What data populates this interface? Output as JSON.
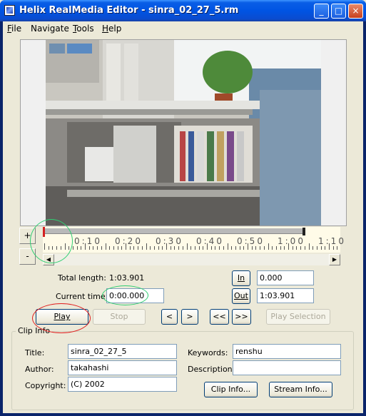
{
  "window": {
    "title": "Helix RealMedia Editor - sinra_02_27_5.rm",
    "controls": [
      "_",
      "□",
      "×"
    ]
  },
  "menu": [
    {
      "label": "File",
      "accel": "F",
      "rest": "ile"
    },
    {
      "label": "Navigate",
      "accel": "",
      "rest": "Navigate"
    },
    {
      "label": "Tools",
      "accel": "T",
      "rest": "ools"
    },
    {
      "label": "Help",
      "accel": "H",
      "rest": "elp"
    }
  ],
  "zoom": {
    "plus": "+",
    "minus": "-"
  },
  "timeline": {
    "labels": [
      "0:10",
      "0:20",
      "0:30",
      "0:40",
      "0:50",
      "1:00",
      "1:10"
    ],
    "scroll_left": "◀",
    "scroll_right": "▶"
  },
  "info": {
    "total_length_label": "Total length:",
    "total_length_value": "1:03.901",
    "current_time_label": "Current time:",
    "current_time_value": "0:00.000"
  },
  "marks": {
    "in_label": "In",
    "in_value": "0.000",
    "out_label": "Out",
    "out_value": "1:03.901"
  },
  "transport": {
    "play": "Play",
    "stop": "Stop",
    "prev": "<",
    "next": ">",
    "rewind": "<<",
    "forward": ">>",
    "play_selection": "Play Selection"
  },
  "clip_info": {
    "group_title": "Clip Info",
    "title_label": "Title:",
    "title_value": "sinra_02_27_5",
    "author_label": "Author:",
    "author_value": "takahashi",
    "copyright_label": "Copyright:",
    "copyright_value": "(C) 2002",
    "keywords_label": "Keywords:",
    "keywords_value": "renshu",
    "description_label": "Description:",
    "description_value": "",
    "clip_info_button": "Clip Info...",
    "stream_info_button": "Stream Info..."
  },
  "colors": {
    "annotation_green": "#2fcf72",
    "annotation_red": "#e02020",
    "timeline_bg": "#fffbe8",
    "playhead": "#d42020"
  }
}
